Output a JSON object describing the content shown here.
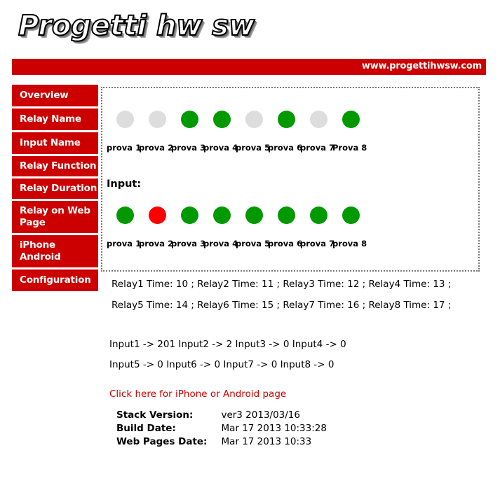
{
  "header": {
    "logo_text": "Progetti hw sw",
    "brand_url": "www.progettihwsw.com"
  },
  "sidebar": {
    "items": [
      {
        "label": "Overview"
      },
      {
        "label": "Relay Name"
      },
      {
        "label": "Input Name"
      },
      {
        "label": "Relay Function"
      },
      {
        "label": "Relay Duration"
      },
      {
        "label": "Relay on Web Page"
      },
      {
        "label": "iPhone Android"
      },
      {
        "label": "Configuration"
      }
    ]
  },
  "status_panel": {
    "relays": [
      {
        "label": "prova 1",
        "state": "off"
      },
      {
        "label": "prova 2",
        "state": "off"
      },
      {
        "label": "prova 3",
        "state": "on"
      },
      {
        "label": "prova 4",
        "state": "on"
      },
      {
        "label": "prova 5",
        "state": "off"
      },
      {
        "label": "prova 6",
        "state": "on"
      },
      {
        "label": "prova 7",
        "state": "off"
      },
      {
        "label": "Prova 8",
        "state": "on"
      }
    ],
    "input_heading": "Input:",
    "inputs": [
      {
        "label": "prova 1",
        "state": "on"
      },
      {
        "label": "prova 2",
        "state": "alarm"
      },
      {
        "label": "prova 3",
        "state": "on"
      },
      {
        "label": "prova 4",
        "state": "on"
      },
      {
        "label": "prova 5",
        "state": "on"
      },
      {
        "label": "prova 6",
        "state": "on"
      },
      {
        "label": "prova 7",
        "state": "on"
      },
      {
        "label": "prova 8",
        "state": "on"
      }
    ]
  },
  "relay_times": {
    "line1": "Relay1 Time: 10 ; Relay2 Time: 11 ; Relay3 Time: 12 ; Relay4 Time: 13 ;",
    "line2": "Relay5 Time: 14 ; Relay6 Time: 15 ; Relay7 Time: 16 ; Relay8 Time: 17 ;"
  },
  "input_values": {
    "line1": "Input1 -> 201   Input2 -> 2   Input3 -> 0   Input4 -> 0",
    "line2": "Input5 -> 0   Input6 -> 0   Input7 -> 0   Input8 -> 0"
  },
  "mobile_link": {
    "label": "Click here for iPhone or Android page"
  },
  "version_info": {
    "rows": [
      {
        "key": "Stack Version:",
        "value": "ver3 2013/03/16"
      },
      {
        "key": "Build Date:",
        "value": "Mar 17 2013 10:33:28"
      },
      {
        "key": "Web Pages Date:",
        "value": "Mar 17 2013 10:33"
      }
    ]
  },
  "colors": {
    "brand_red": "#cc0000",
    "on_green": "#009900",
    "off_gray": "#dddddd",
    "alarm_red": "#ff0000"
  }
}
